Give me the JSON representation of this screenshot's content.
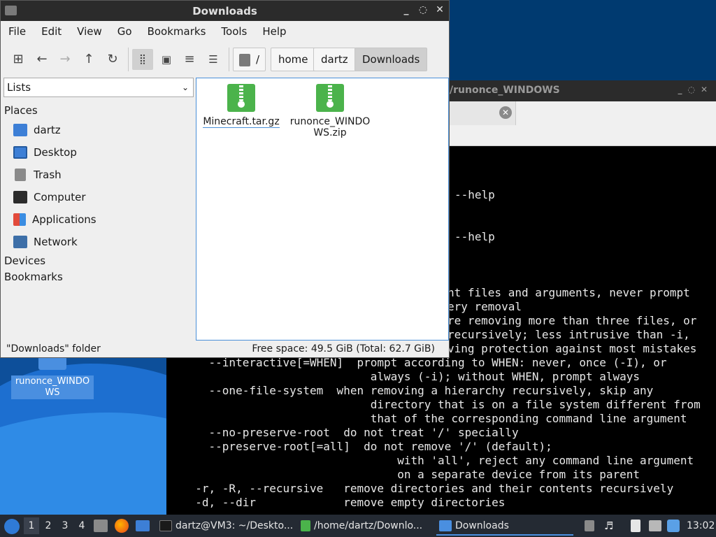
{
  "desktop": {
    "icon_label": "runonce_WINDOWS"
  },
  "terminal": {
    "title": "/runonce_WINDOWS",
    "window_controls": [
      "_",
      "◌",
      "✕"
    ],
    "tab_close": "✕",
    "lines": [
      "--help",
      "--help",
      "nt files and arguments, never prompt",
      "ery removal",
      "re removing more than three files, or",
      "recursively; less intrusive than -i,",
      "ving protection against most mistakes",
      "    --interactive[=WHEN]  prompt according to WHEN: never, once (-I), or",
      "                            always (-i); without WHEN, prompt always",
      "    --one-file-system  when removing a hierarchy recursively, skip any",
      "                            directory that is on a file system different from",
      "                            that of the corresponding command line argument",
      "    --no-preserve-root  do not treat '/' specially",
      "    --preserve-root[=all]  do not remove '/' (default);",
      "                                with 'all', reject any command line argument",
      "                                on a separate device from its parent",
      "  -r, -R, --recursive   remove directories and their contents recursively",
      "  -d, --dir             remove empty directories"
    ]
  },
  "file_manager": {
    "title": "Downloads",
    "window_controls": [
      "_",
      "◌",
      "✕"
    ],
    "menu": [
      "File",
      "Edit",
      "View",
      "Go",
      "Bookmarks",
      "Tools",
      "Help"
    ],
    "toolbar": {
      "new_tab": "⊞",
      "back": "←",
      "forward": "→",
      "up": "↑",
      "reload": "↻",
      "icon_view": "⣿",
      "thumb_view": "▣",
      "compact_view": "≡",
      "list_view": "☰"
    },
    "breadcrumbs": [
      "/",
      "home",
      "dartz",
      "Downloads"
    ],
    "side_selector": "Lists",
    "side_chevron": "⌄",
    "places_heading": "Places",
    "places": [
      "dartz",
      "Desktop",
      "Trash",
      "Computer",
      "Applications",
      "Network"
    ],
    "devices_heading": "Devices",
    "bookmarks_heading": "Bookmarks",
    "files": [
      "Minecraft.tar.gz",
      "runonce_WINDOWS.zip"
    ],
    "status_left": "\"Downloads\" folder",
    "status_right": "Free space: 49.5 GiB (Total: 62.7 GiB)"
  },
  "taskbar": {
    "workspaces": [
      "1",
      "2",
      "3",
      "4"
    ],
    "tasks": [
      "dartz@VM3: ~/Deskto...",
      "/home/dartz/Downlo...",
      "Downloads"
    ],
    "clock": "13:02"
  },
  "colors": {
    "accent": "#4a8fe0",
    "desktop_bg": "#003a70",
    "taskbar_bg": "#242a33",
    "zip_green": "#4bb34b"
  }
}
